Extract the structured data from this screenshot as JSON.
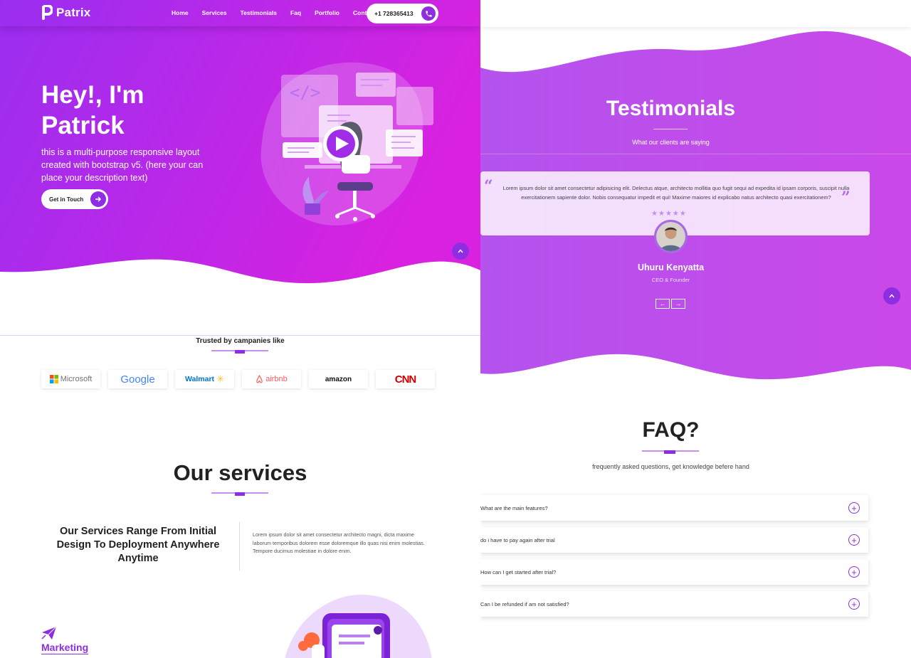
{
  "brand": {
    "name": "Patrix"
  },
  "nav": {
    "links": [
      "Home",
      "Services",
      "Testimonials",
      "Faq",
      "Portfolio",
      "Contact"
    ],
    "phone": "+1 728365413"
  },
  "hero": {
    "title": "Hey!, I'm Patrick",
    "description": "this is a multi-purpose responsive layout created with bootstrap v5. (here your can place your description text)",
    "cta": "Get in Touch"
  },
  "trusted": {
    "title": "Trusted by campanies like",
    "logos": [
      "Microsoft",
      "Google",
      "Walmart",
      "airbnb",
      "amazon",
      "CNN"
    ]
  },
  "services": {
    "title": "Our services",
    "subtitle": "Our Services Range From Initial Design To Deployment Anywhere Anytime",
    "description": "Lorem ipsum dolor sit amet consectetur architecto magni, dicta maxime laborum temporibus dolorem esse doloremque illo quas nisi enim molestias. Tempore ducimus molestiae in dolore enim.",
    "first_service": "Marketing"
  },
  "testimonials": {
    "title": "Testimonials",
    "subtitle": "What our clients are saying",
    "quote": "Lorem ipsum dolor sit amet consectetur adipisicing elit. Delectus atque, architecto mollitia quo fugit sequi ad expedita id ipsam corporis, suscipit nulla exercitationem sapiente dolor. Nobis consequatur impedit et qui! Maxime maiores id explicabo natus architecto quasi exercitationem?",
    "rating": 5,
    "person_name": "Uhuru Kenyatta",
    "person_role": "CEO & Founder",
    "prev_label": "←",
    "next_label": "→"
  },
  "faq": {
    "title": "FAQ?",
    "subtitle": "frequently asked questions, get knowledge befere hand",
    "items": [
      "What are the main features?",
      "do i have to pay again after trial",
      "How can I get started after trial?",
      "Can I be refunded if am not satisfied?"
    ]
  },
  "colors": {
    "accent": "#8e2de2",
    "gradient_start": "#9a2ef0",
    "gradient_end": "#d822e0",
    "testimonial_start": "#b453ee",
    "testimonial_end": "#c948e8"
  }
}
